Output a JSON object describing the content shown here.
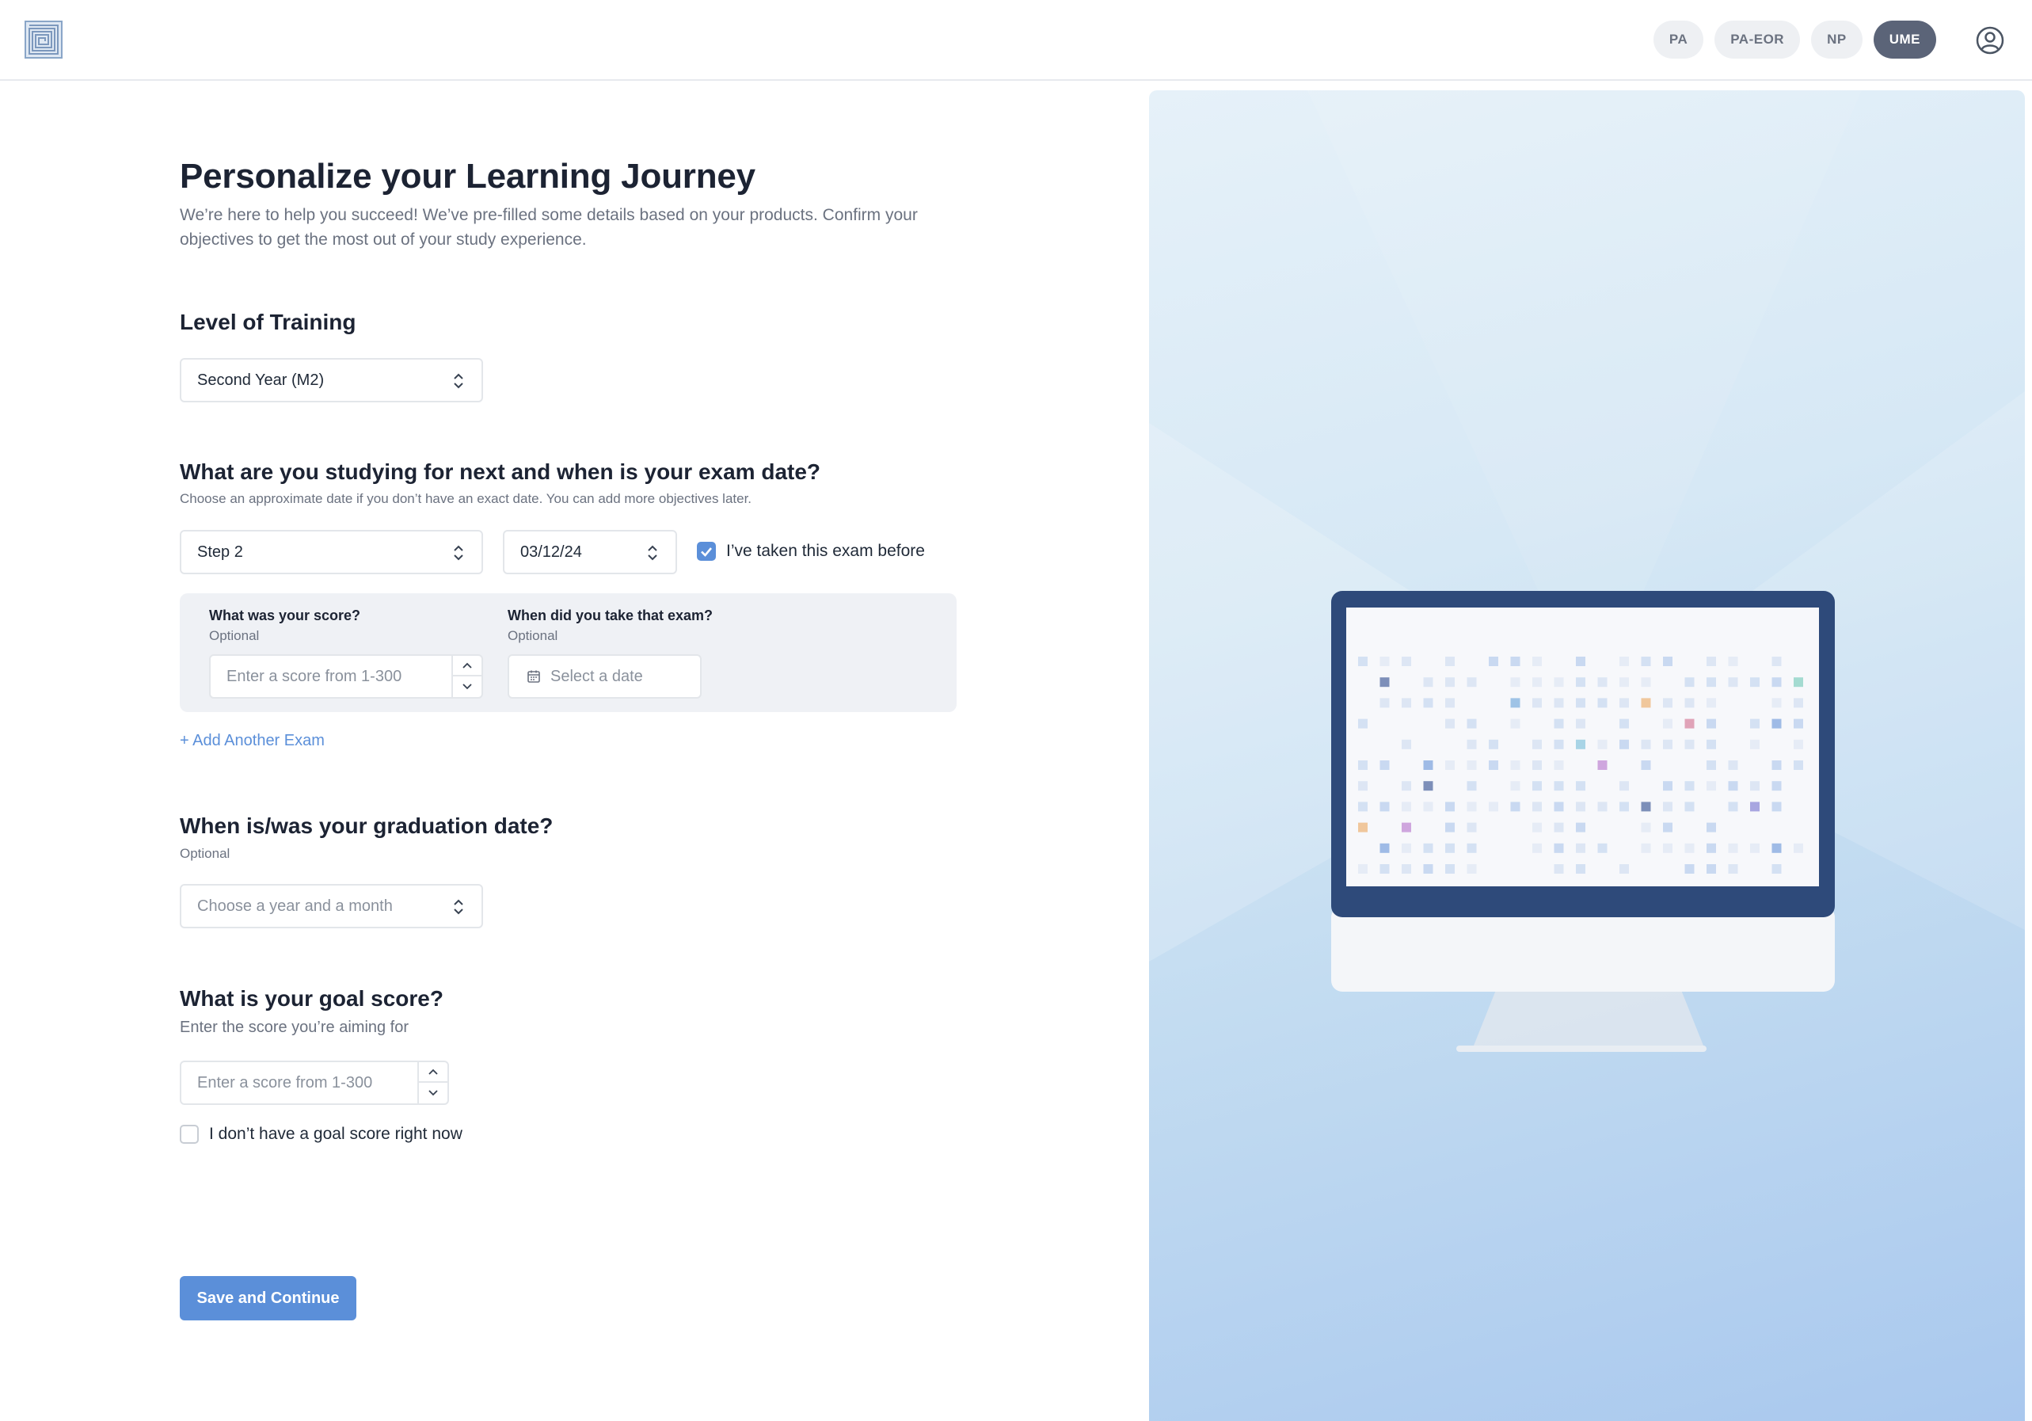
{
  "header": {
    "products": [
      {
        "label": "PA",
        "active": false
      },
      {
        "label": "PA-EOR",
        "active": false
      },
      {
        "label": "NP",
        "active": false
      },
      {
        "label": "UME",
        "active": true
      }
    ]
  },
  "page": {
    "title": "Personalize your Learning Journey",
    "intro": "We’re here to help you succeed! We’ve pre-filled some details based on your products. Confirm your objectives to get the most out of your study experience."
  },
  "level": {
    "heading": "Level of Training",
    "value": "Second Year (M2)"
  },
  "exam": {
    "heading": "What are you studying for next and when is your exam date?",
    "subtext": "Choose an approximate date if you don’t have an exact date. You can add more objectives later.",
    "exam_value": "Step 2",
    "date_value": "03/12/24",
    "taken_before_label": "I’ve taken this exam before",
    "taken_before_checked": true,
    "score_label": "What was your score?",
    "score_optional": "Optional",
    "score_placeholder": "Enter a score from 1-300",
    "taken_date_label": "When did you take that exam?",
    "taken_date_optional": "Optional",
    "taken_date_placeholder": "Select a date",
    "add_another": "+ Add Another Exam"
  },
  "graduation": {
    "heading": "When is/was your graduation date?",
    "optional": "Optional",
    "placeholder": "Choose a year and a month"
  },
  "goal": {
    "heading": "What is your goal score?",
    "subtext": "Enter the score you’re aiming for",
    "placeholder": "Enter a score from 1-300",
    "no_goal_label": "I don’t have a goal score right now",
    "no_goal_checked": false
  },
  "actions": {
    "save_label": "Save and Continue"
  },
  "colors": {
    "accent": "#5b8fd9",
    "active_pill": "#5b6478",
    "monitor_frame": "#2e4a7a"
  }
}
